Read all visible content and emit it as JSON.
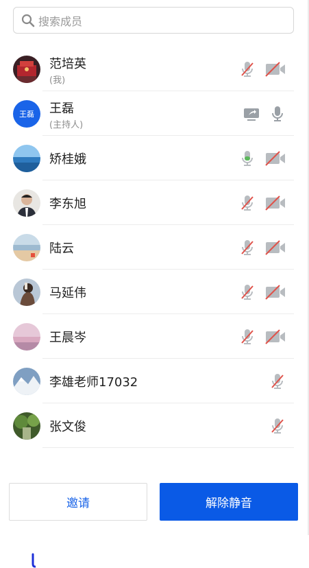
{
  "search": {
    "placeholder": "搜索成员"
  },
  "participants": [
    {
      "name": "范培英",
      "role": "(我)",
      "avatar": "photo-red-building",
      "screen_share": false,
      "mic": "muted",
      "camera": "off"
    },
    {
      "name": "王磊",
      "role": "(主持人)",
      "avatar_text": "王磊",
      "screen_share": true,
      "mic": "on",
      "camera": "none"
    },
    {
      "name": "矫桂娥",
      "avatar": "photo-sea",
      "screen_share": false,
      "mic": "active",
      "camera": "off"
    },
    {
      "name": "李东旭",
      "avatar": "photo-portrait",
      "screen_share": false,
      "mic": "muted",
      "camera": "off"
    },
    {
      "name": "陆云",
      "avatar": "photo-beach",
      "screen_share": false,
      "mic": "muted",
      "camera": "off"
    },
    {
      "name": "马延伟",
      "avatar": "photo-person",
      "screen_share": false,
      "mic": "muted",
      "camera": "off"
    },
    {
      "name": "王晨岑",
      "avatar": "photo-pink-sky",
      "screen_share": false,
      "mic": "muted",
      "camera": "off"
    },
    {
      "name": "李雄老师17032",
      "avatar": "photo-snow-mountain",
      "screen_share": false,
      "mic": "muted",
      "camera": "none"
    },
    {
      "name": "张文俊",
      "avatar": "photo-forest",
      "screen_share": false,
      "mic": "muted",
      "camera": "none"
    }
  ],
  "buttons": {
    "invite": "邀请",
    "unmute": "解除静音"
  },
  "colors": {
    "accent": "#1a64e8",
    "primary_button": "#0a5ae6",
    "muted_red": "#e0524a",
    "mic_active_green": "#5cb85c",
    "icon_gray": "#9aa0a6"
  }
}
